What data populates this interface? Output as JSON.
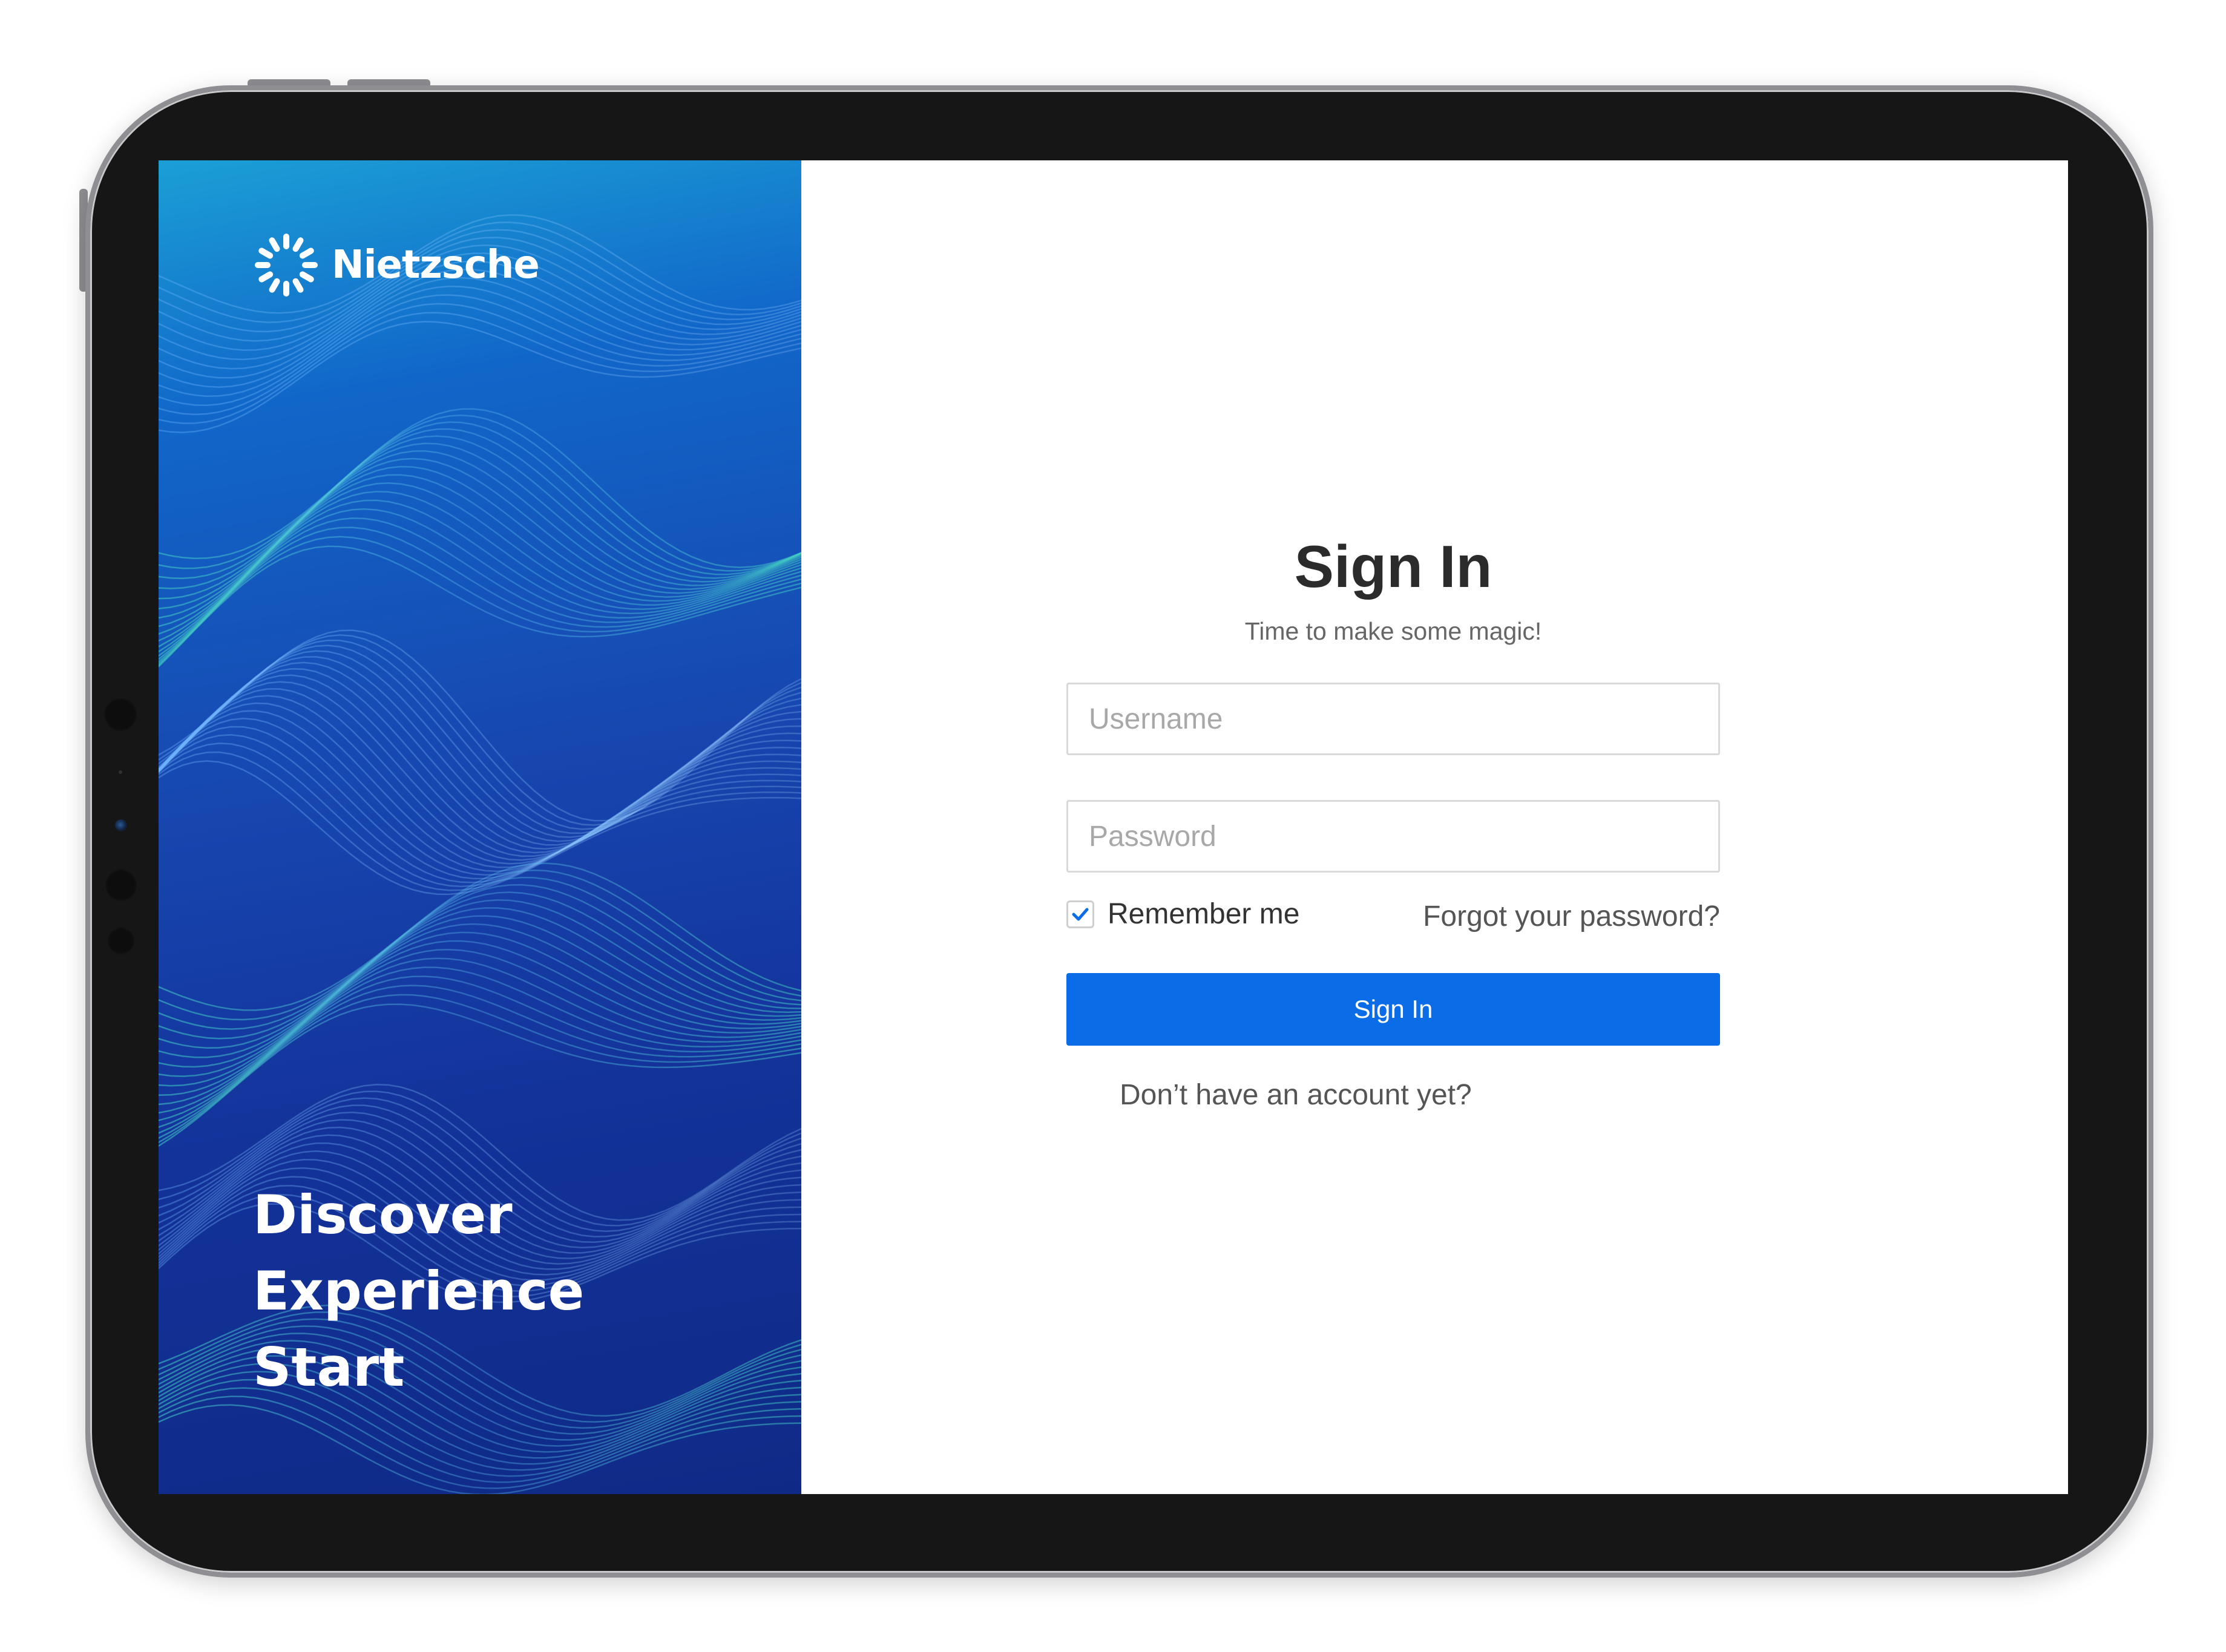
{
  "brand": {
    "name": "Nietzsche",
    "logo_icon": "sunburst-icon"
  },
  "hero": {
    "tagline": [
      "Discover",
      "Experience",
      "Start"
    ],
    "colors": {
      "top": "#1b9fd6",
      "middle": "#1747b0",
      "bottom": "#0f2a86",
      "wave_highlight": "#3fd1c0"
    }
  },
  "signin": {
    "title": "Sign In",
    "subtitle": "Time to make some magic!",
    "username_placeholder": "Username",
    "password_placeholder": "Password",
    "remember_label": "Remember me",
    "remember_checked": true,
    "forgot_label": "Forgot your password?",
    "button_label": "Sign In",
    "signup_prompt": "Don’t have an account yet?"
  },
  "colors": {
    "accent": "#0a6ce6",
    "title_text": "#2b2b2b",
    "muted_text": "#666666"
  }
}
